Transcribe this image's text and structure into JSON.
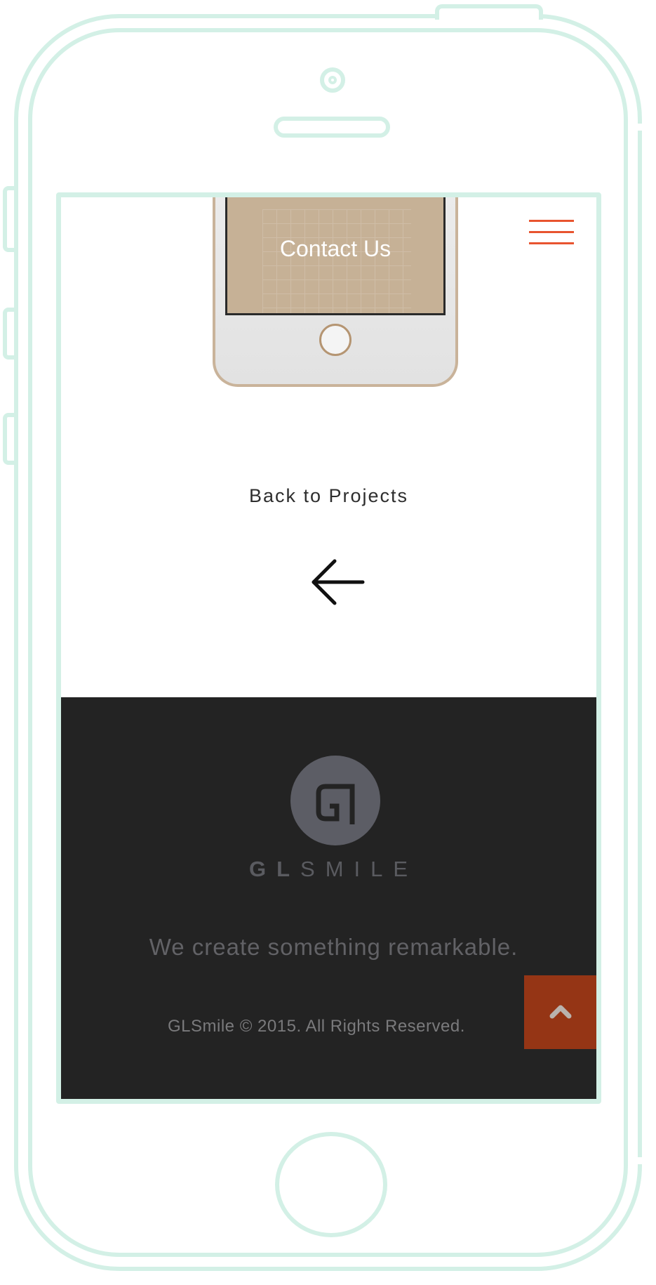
{
  "mockup": {
    "title": "Contact Us"
  },
  "nav": {
    "menu_icon": "hamburger-icon"
  },
  "back": {
    "label": "Back to Projects",
    "icon": "arrow-left-icon"
  },
  "footer": {
    "logo_icon": "gl-monogram-logo",
    "brand_bold": "GL",
    "brand_light": "SMILE",
    "tagline": "We create something remarkable.",
    "copyright": "GLSmile © 2015. All Rights Reserved.",
    "back_to_top_icon": "chevron-up-icon"
  },
  "colors": {
    "accent": "#e8542f",
    "frame": "#d3f0e6",
    "footer_bg": "#232323",
    "back_to_top": "#953515",
    "mockup_screen": "#c6b196"
  }
}
